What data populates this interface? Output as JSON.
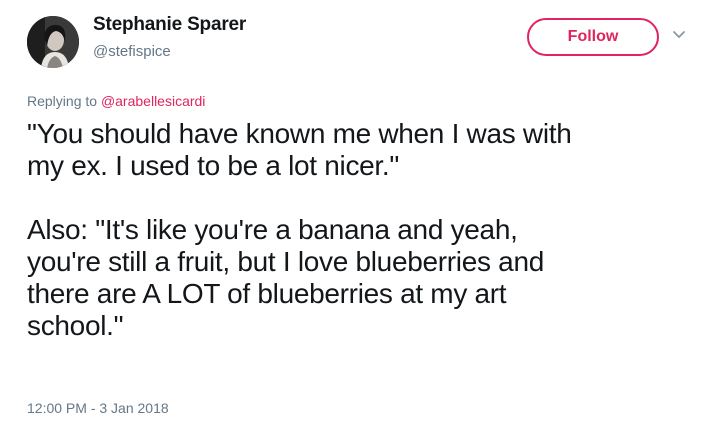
{
  "tweet": {
    "author": {
      "display_name": "Stephanie Sparer",
      "handle": "@stefispice"
    },
    "follow_label": "Follow",
    "reply": {
      "prefix": "Replying to ",
      "mention": "@arabellesicardi"
    },
    "paragraphs": [
      "\"You should have known me when I was with\nmy ex. I used to be a lot nicer.\"",
      "Also: \"It's like you're a banana and yeah,\nyou're still a fruit, but I love blueberries and\nthere are A LOT of blueberries at my art\nschool.\""
    ],
    "timestamp": "12:00 PM - 3 Jan 2018"
  },
  "colors": {
    "accent": "#e0245e",
    "secondary_text": "#657786",
    "primary_text": "#14171a"
  },
  "icons": {
    "menu": "chevron-down-icon"
  }
}
